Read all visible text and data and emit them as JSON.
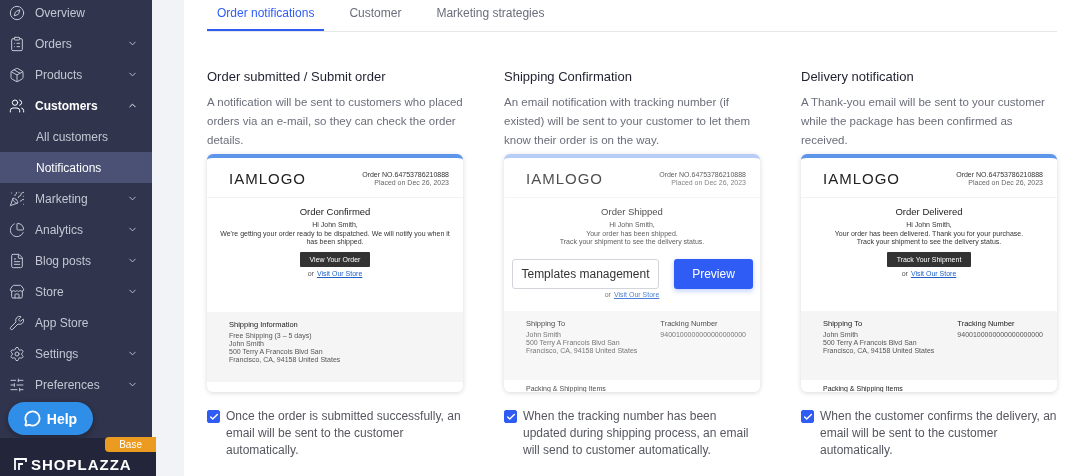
{
  "sidebar": {
    "items": [
      {
        "label": "Overview",
        "selected": false
      },
      {
        "label": "Orders",
        "selected": false,
        "expanded": false
      },
      {
        "label": "Products",
        "selected": false,
        "expanded": false
      },
      {
        "label": "Customers",
        "selected": true,
        "expanded": true,
        "children": [
          {
            "label": "All customers",
            "selected": false
          },
          {
            "label": "Notifications",
            "selected": true
          }
        ]
      },
      {
        "label": "Marketing",
        "selected": false,
        "expanded": false
      },
      {
        "label": "Analytics",
        "selected": false,
        "expanded": false
      },
      {
        "label": "Blog posts",
        "selected": false,
        "expanded": false
      },
      {
        "label": "Store",
        "selected": false,
        "expanded": false
      },
      {
        "label": "App Store",
        "selected": false
      },
      {
        "label": "Settings",
        "selected": false,
        "expanded": false
      },
      {
        "label": "Preferences",
        "selected": false,
        "expanded": false
      }
    ],
    "help": "Help",
    "plan_badge": "Base",
    "brand": "SHOPLAZZA"
  },
  "tabs": [
    {
      "label": "Order notifications",
      "selected": true
    },
    {
      "label": "Customer",
      "selected": false
    },
    {
      "label": "Marketing strategies",
      "selected": false
    }
  ],
  "notifications": [
    {
      "title": "Order submitted / Submit order",
      "description": "A notification will be sent to customers who placed orders via an e-mail, so they can check the order details.",
      "hovered": false,
      "preview": {
        "logo": "IAMLOGO",
        "order_no": "Order NO.64753786210888",
        "placed": "Placed on Dec 26, 2023",
        "heading": "Order Confirmed",
        "greeting": "Hi  John Smith,",
        "body": "We're getting your order ready to be dispatched. We will notify you when it has been shipped.",
        "button": "View Your Order",
        "or": "or",
        "link": "Visit Our Store",
        "sections": [
          {
            "heading": "Shipping Information",
            "lines": [
              "Free Shipping (3 – 5 days)",
              "John Smith",
              "500 Terry A Francois Blvd San",
              "Francisco, CA, 94158 United States"
            ]
          }
        ]
      },
      "checkbox": {
        "checked": true,
        "label": "Once the order is submitted successfully, an email will be sent to the customer automatically."
      }
    },
    {
      "title": "Shipping Confirmation",
      "description": "An email notification with tracking number (if existed) will be sent to your customer to let them know their order is on the way.",
      "hovered": true,
      "preview": {
        "logo": "IAMLOGO",
        "order_no": "Order NO.64753786210888",
        "placed": "Placed on Dec 26, 2023",
        "heading": "Order Shipped",
        "greeting": "Hi  John Smith,",
        "body": "Your order has been shipped.\nTrack your shipment to see the delivery status.",
        "or": "or",
        "link": "Visit Our Store",
        "sections": [
          {
            "heading": "Shipping To",
            "lines": [
              "John Smith",
              "500 Terry A Francois Blvd San",
              "Francisco, CA, 94158 United States"
            ]
          },
          {
            "heading": "Tracking Number",
            "lines": [
              "9400100000000000000000"
            ]
          }
        ],
        "footer": "Packing & Shipping Items"
      },
      "actions": [
        "Templates management",
        "Preview"
      ],
      "checkbox": {
        "checked": true,
        "label": "When the tracking number has been updated during shipping process, an email will send to customer automatically."
      }
    },
    {
      "title": "Delivery notification",
      "description": "A Thank-you email will be sent to your customer while the package has been confirmed as received.",
      "hovered": false,
      "preview": {
        "logo": "IAMLOGO",
        "order_no": "Order NO.64753786210888",
        "placed": "Placed on Dec 26, 2023",
        "heading": "Order Delivered",
        "greeting": "Hi  John Smith,",
        "body": "Your order has been delivered. Thank you for your purchase.\nTrack your shipment to see the delivery status.",
        "button": "Track Your Shipment",
        "or": "or",
        "link": "Visit Our Store",
        "sections": [
          {
            "heading": "Shipping To",
            "lines": [
              "John Smith",
              "500 Terry A Francois Blvd San",
              "Francisco, CA, 94158 United States"
            ]
          },
          {
            "heading": "Tracking Number",
            "lines": [
              "9400100000000000000000"
            ]
          }
        ],
        "footer": "Packing & Shipping Items"
      },
      "checkbox": {
        "checked": true,
        "label": "When the customer confirms the delivery, an email will be sent to the customer automatically."
      }
    }
  ]
}
